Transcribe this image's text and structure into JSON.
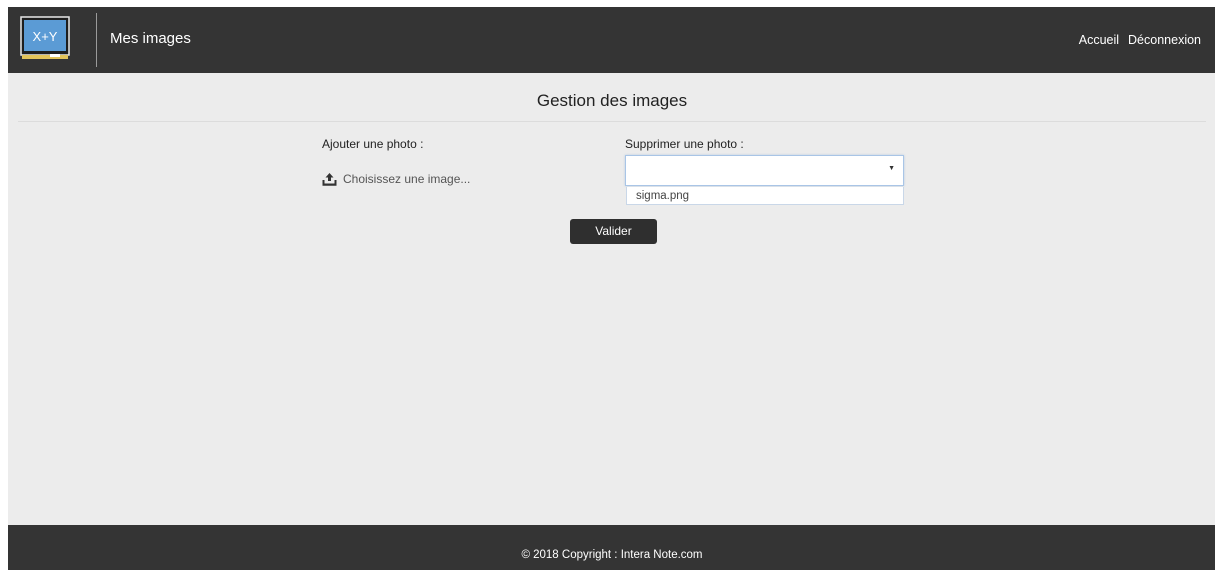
{
  "header": {
    "logo_text": "X+Y",
    "title": "Mes images",
    "nav": {
      "home": "Accueil",
      "logout": "Déconnexion"
    }
  },
  "main": {
    "title": "Gestion des images",
    "add_photo": {
      "label": "Ajouter une photo :",
      "upload_icon": "upload-icon",
      "upload_text": "Choisissez une image..."
    },
    "delete_photo": {
      "label": "Supprimer une photo :",
      "selected_value": "",
      "options": [
        "sigma.png"
      ]
    },
    "submit_label": "Valider"
  },
  "footer": {
    "copyright": "© 2018 Copyright : Intera Note.com"
  },
  "colors": {
    "header_bg": "#343434",
    "page_bg": "#ececec",
    "button_bg": "#2f2f2f",
    "select_focus_border": "#a9c5e6",
    "logo_blue": "#5b9bd5"
  }
}
